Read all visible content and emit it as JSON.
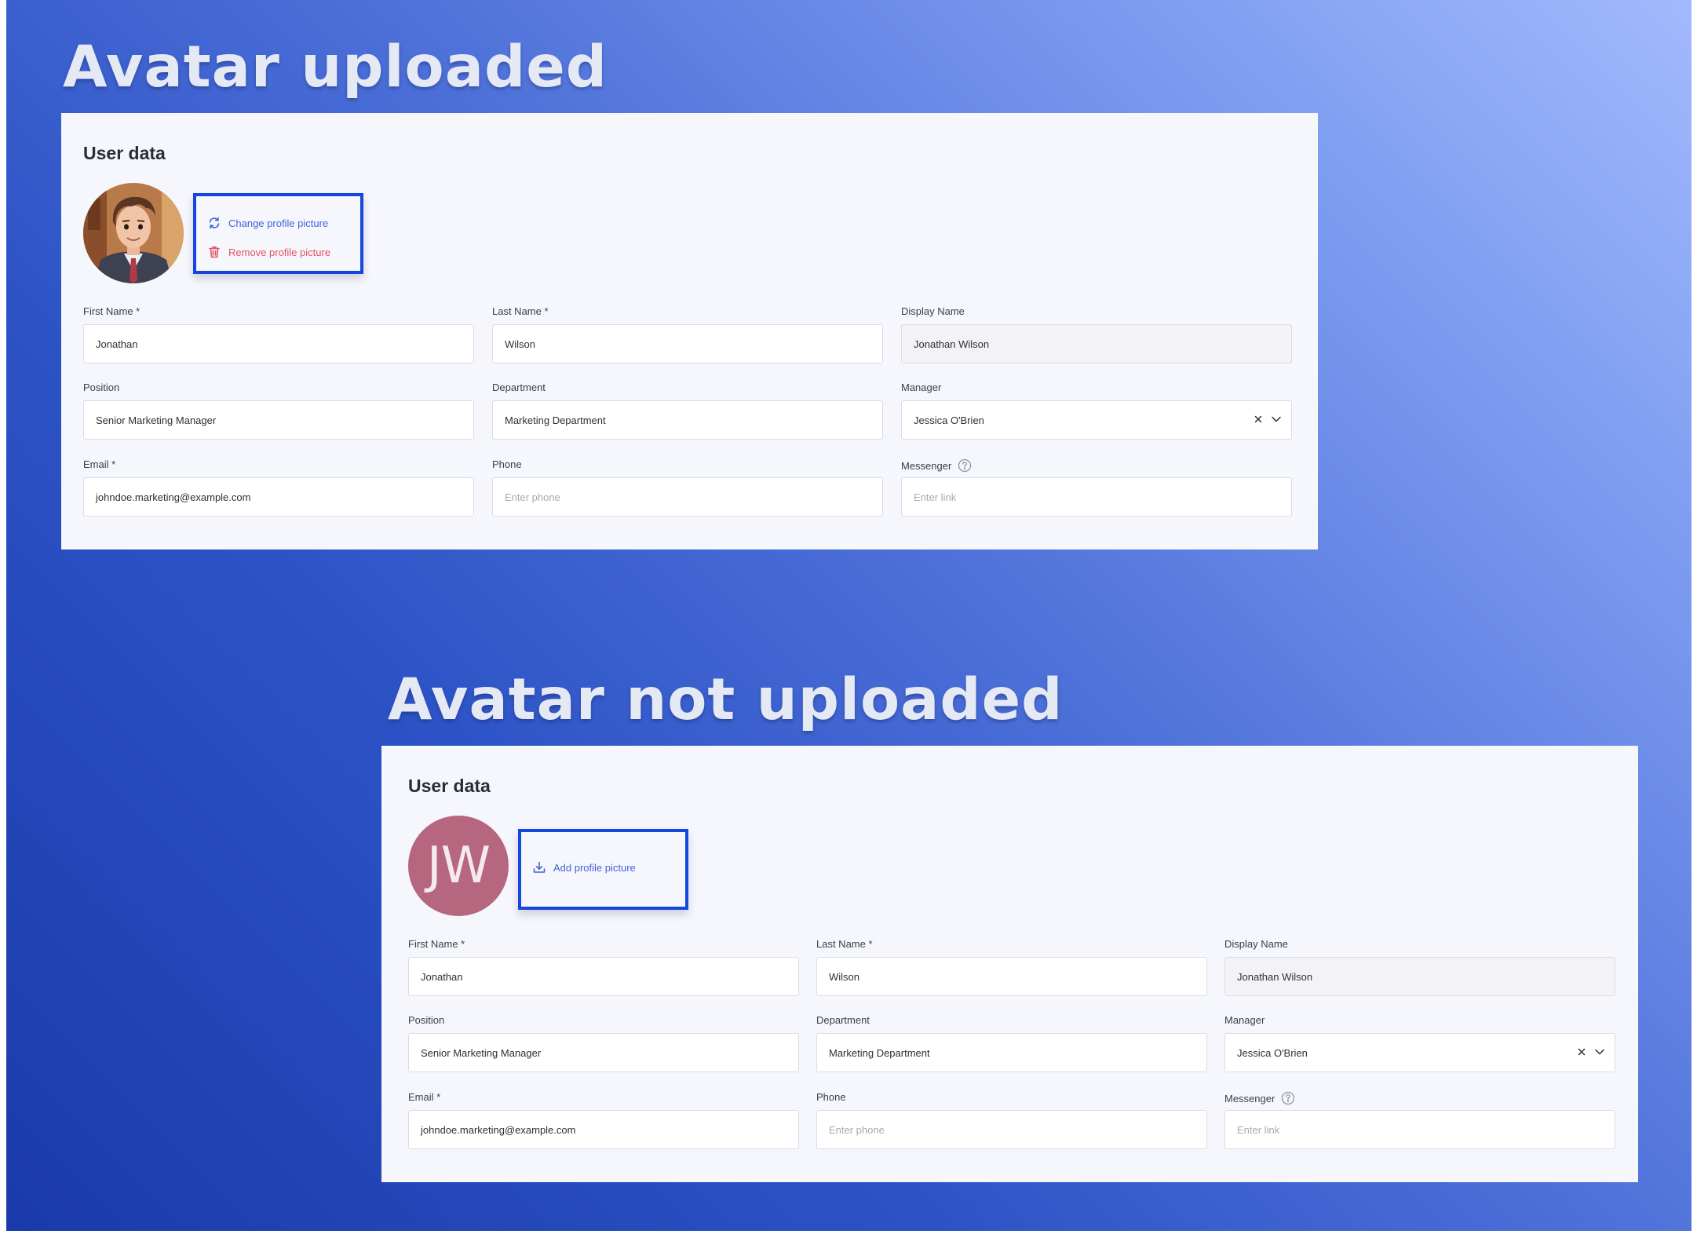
{
  "sections": [
    {
      "heading": "Avatar uploaded",
      "card_title": "User data",
      "avatar": {
        "type": "photo",
        "icon": "avatar-illustration"
      },
      "actions": [
        {
          "label": "Change profile picture",
          "icon": "refresh-icon",
          "color": "#3f63d8"
        },
        {
          "label": "Remove profile picture",
          "icon": "trash-icon",
          "color": "#e05364"
        }
      ]
    },
    {
      "heading": "Avatar not uploaded",
      "card_title": "User data",
      "avatar": {
        "type": "initials",
        "initials": "JW",
        "color": "#b6667f"
      },
      "actions": [
        {
          "label": "Add profile picture",
          "icon": "download-icon",
          "color": "#3f63d8"
        }
      ]
    }
  ],
  "form": {
    "first_name": {
      "label": "First Name *",
      "value": "Jonathan"
    },
    "last_name": {
      "label": "Last Name *",
      "value": "Wilson"
    },
    "display_name": {
      "label": "Display Name",
      "value": "Jonathan Wilson"
    },
    "position": {
      "label": "Position",
      "value": "Senior Marketing Manager"
    },
    "department": {
      "label": "Department",
      "value": "Marketing Department"
    },
    "manager": {
      "label": "Manager",
      "value": "Jessica O'Brien"
    },
    "email": {
      "label": "Email *",
      "value": "johndoe.marketing@example.com"
    },
    "phone": {
      "label": "Phone",
      "placeholder": "Enter phone"
    },
    "messenger": {
      "label": "Messenger",
      "placeholder": "Enter link"
    }
  },
  "colors": {
    "accent": "#1546e0",
    "link": "#3f63d8",
    "danger": "#e05364",
    "background_start": "#a3b9fd",
    "background_end": "#1a3aaa"
  }
}
